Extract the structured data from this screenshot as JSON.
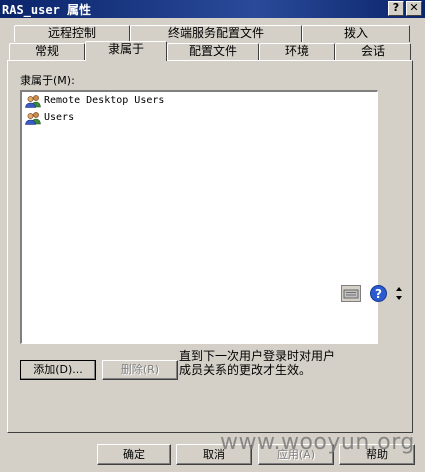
{
  "window": {
    "title": "RAS_user 属性",
    "help_button": "?",
    "close_button": "✕"
  },
  "tabs": {
    "back_row": [
      "远程控制",
      "终端服务配置文件",
      "拨入"
    ],
    "front_row": [
      "常规",
      "隶属于",
      "配置文件",
      "环境",
      "会话"
    ],
    "active": "隶属于"
  },
  "memberof": {
    "label": "隶属于(M):",
    "items": [
      "Remote Desktop Users",
      "Users"
    ],
    "add_button": "添加(D)...",
    "remove_button": "删除(R)",
    "note_line1": "直到下一次用户登录时对用户",
    "note_line2": "成员关系的更改才生效。"
  },
  "tray": {
    "help_label": "?",
    "keyboard_icon": "keyboard-icon"
  },
  "footer": {
    "ok": "确定",
    "cancel": "取消",
    "apply": "应用(A)",
    "help": "帮助"
  },
  "watermark": "www.wooyun.org",
  "colors": {
    "titlebar": "#0a246a",
    "face": "#d4d0c8",
    "list_bg": "#ffffff"
  }
}
